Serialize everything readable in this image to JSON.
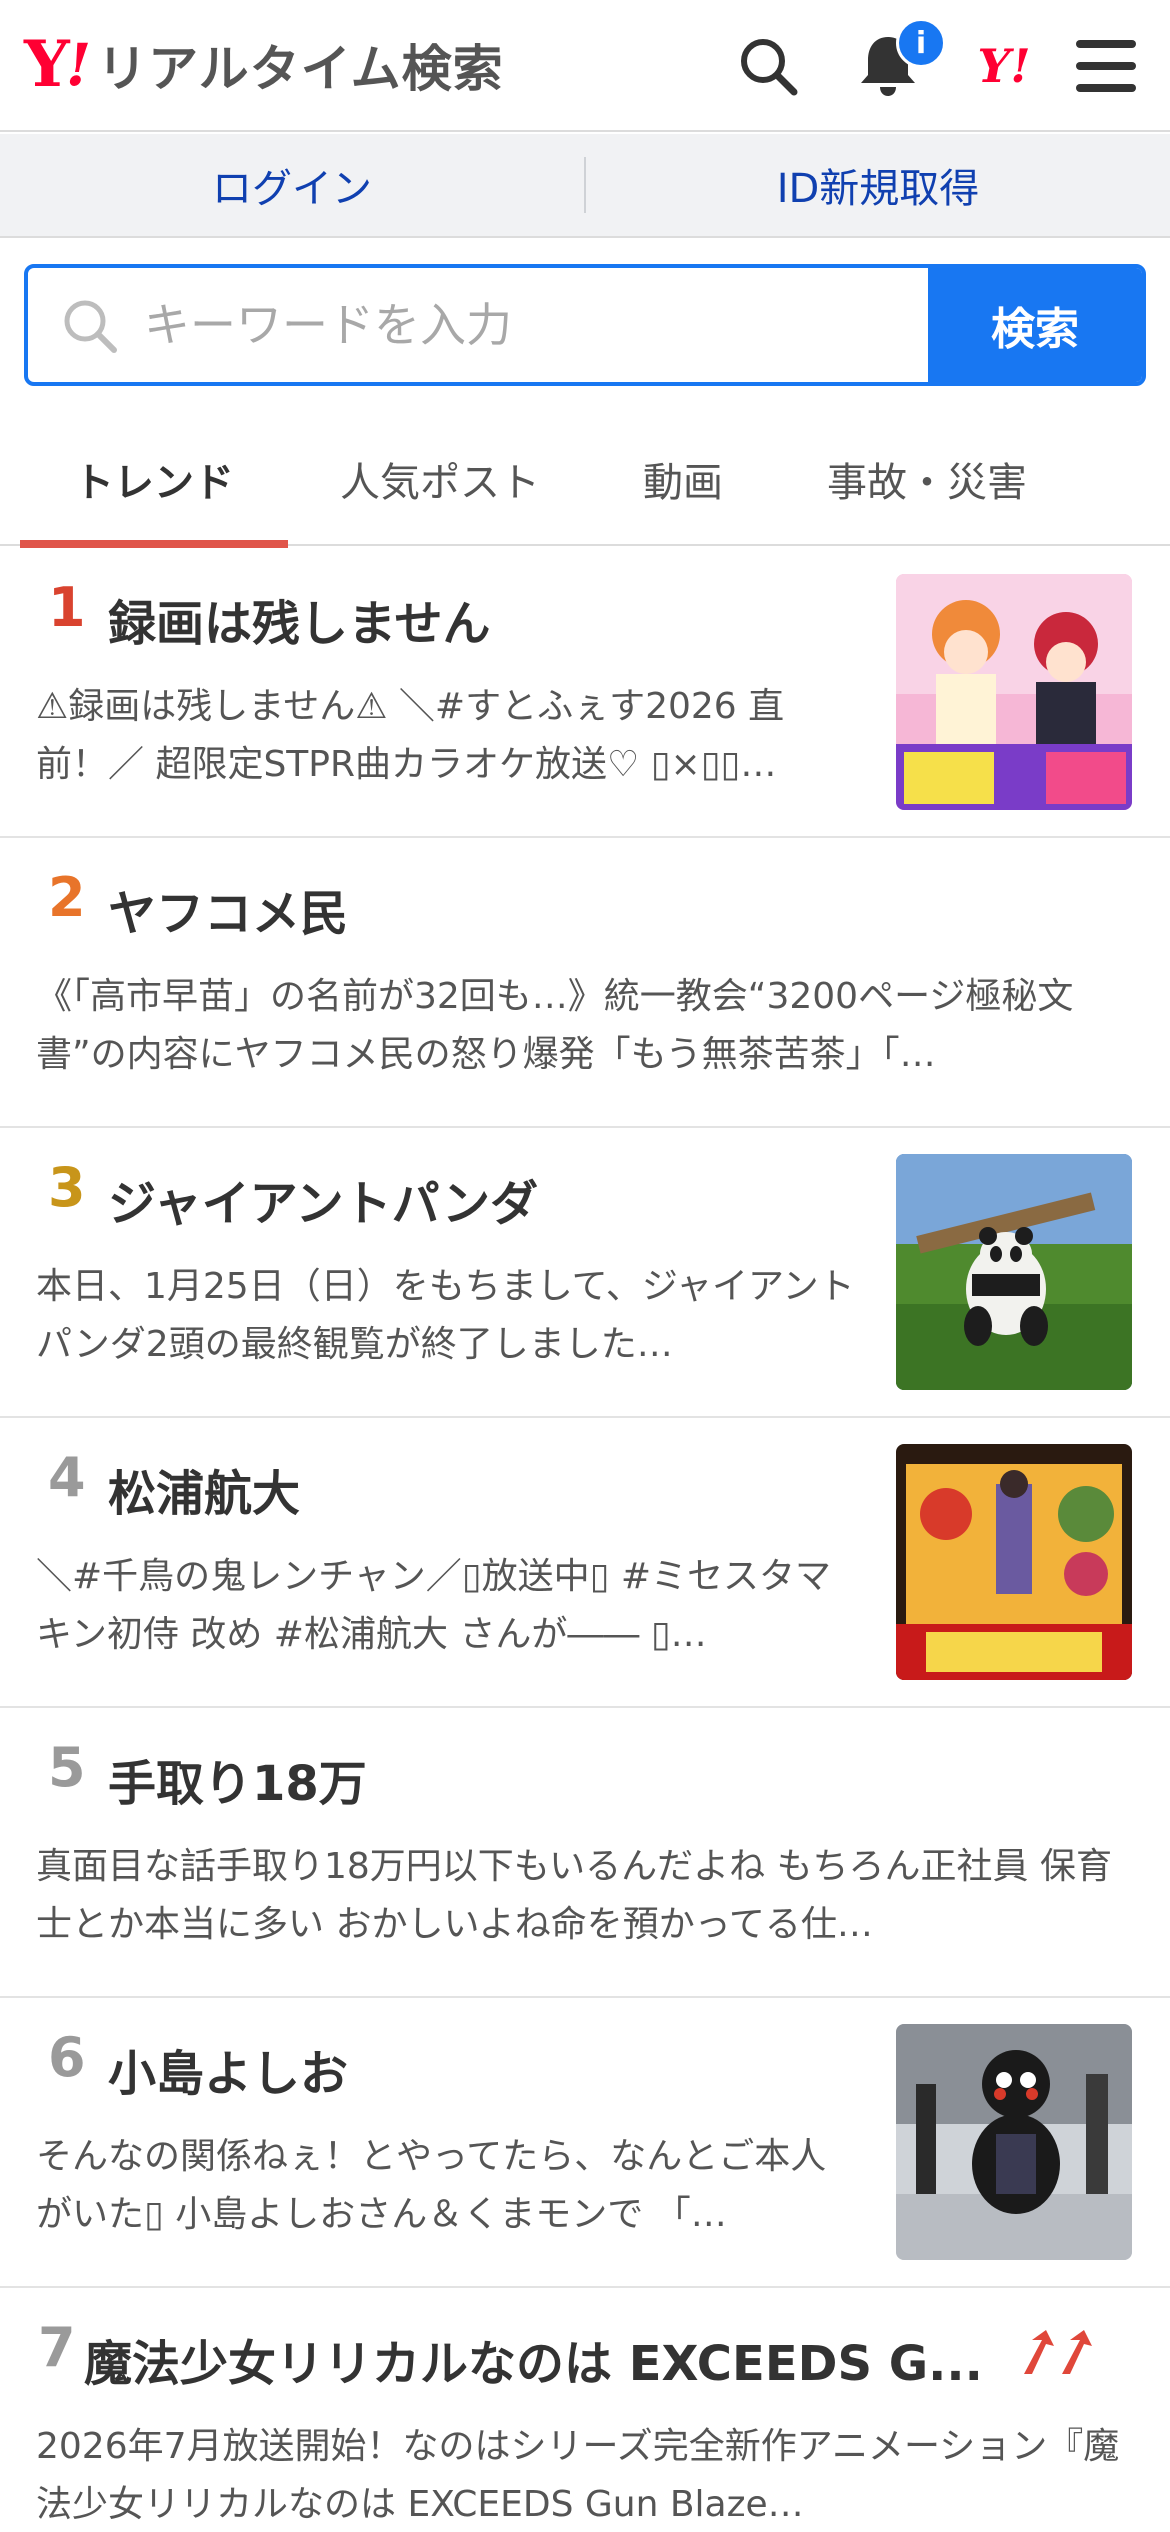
{
  "header": {
    "logo_y": "Y",
    "logo_ex": "!",
    "logo_text": "リアルタイム検索",
    "notification_badge": "i",
    "yj_mark": "Y!"
  },
  "loginbar": {
    "login": "ログイン",
    "signup": "ID新規取得"
  },
  "search": {
    "placeholder": "キーワードを入力",
    "button": "検索"
  },
  "tabs": [
    {
      "label": "トレンド",
      "active": true
    },
    {
      "label": "人気ポスト",
      "active": false
    },
    {
      "label": "動画",
      "active": false
    },
    {
      "label": "事故・災害",
      "active": false
    }
  ],
  "colors": {
    "accent": "#1877f2",
    "rank1": "#d9432f",
    "rank2": "#e8742a",
    "rank3": "#c8951a",
    "rank_other": "#9a9a9a",
    "tab_indicator": "#e0554a",
    "trend_up": "#e0473a"
  },
  "items": [
    {
      "rank": "1",
      "title": "録画は残しません",
      "desc": "⚠録画は残しません⚠ ＼#すとふぇす2026 直前！／ 超限定STPR曲カラオケ放送♡ ▯×▯▯…",
      "thumb": "anime-karaoke-thumbnail"
    },
    {
      "rank": "2",
      "title": "ヤフコメ民",
      "desc": "《「高市早苗」の名前が32回も…》統一教会“3200ページ極秘文書”の内容にヤフコメ民の怒り爆発「もう無茶苦茶」「…",
      "thumb": ""
    },
    {
      "rank": "3",
      "title": "ジャイアントパンダ",
      "desc": "本日、1月25日（日）をもちまして、ジャイアントパンダ2頭の最終観覧が終了しました…",
      "thumb": "panda-photo-thumbnail"
    },
    {
      "rank": "4",
      "title": "松浦航大",
      "desc": "＼#千鳥の鬼レンチャン／▯放送中▯ #ミセスタマキン初侍 改め #松浦航大 さんが―― ▯…",
      "thumb": "tv-show-thumbnail"
    },
    {
      "rank": "5",
      "title": "手取り18万",
      "desc": "真面目な話手取り18万円以下もいるんだよね もちろん正社員 保育士とか本当に多い おかしいよね命を預かってる仕…",
      "thumb": ""
    },
    {
      "rank": "6",
      "title": "小島よしお",
      "desc": "そんなの関係ねぇ！とやってたら、なんとご本人がいた▯ 小島よしおさん＆くまモンで 「…",
      "thumb": "kumamon-photo-thumbnail"
    },
    {
      "rank": "7",
      "title": "魔法少女リリカルなのは EXCEEDS G...",
      "desc": "2026年7月放送開始！なのはシリーズ完全新作アニメーション『魔法少女リリカルなのは EXCEEDS Gun Blaze…",
      "thumb": ""
    }
  ]
}
